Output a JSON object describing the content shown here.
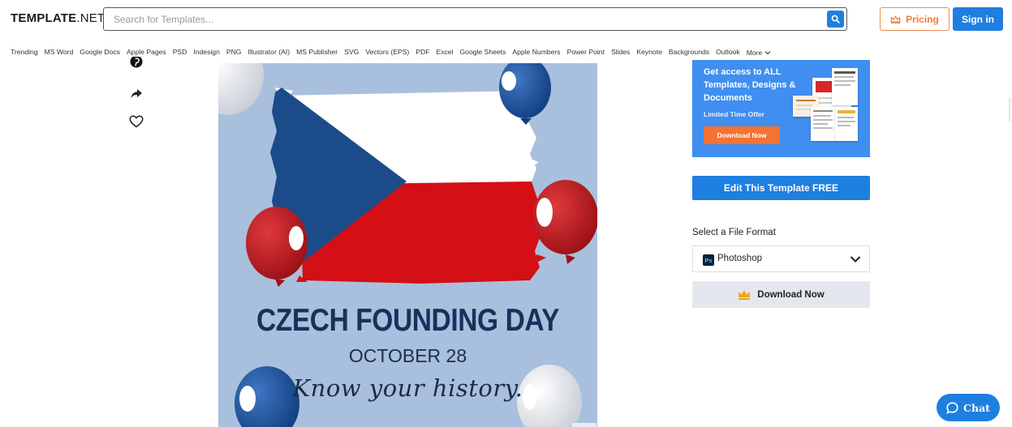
{
  "header": {
    "logo_main": "TEMPLATE",
    "logo_suffix": ".NET",
    "search_placeholder": "Search for Templates...",
    "pricing_label": "Pricing",
    "signin_label": "Sign in"
  },
  "categories": [
    "Trending",
    "MS Word",
    "Google Docs",
    "Apple Pages",
    "PSD",
    "Indesign",
    "PNG",
    "Illustrator (AI)",
    "MS Publisher",
    "SVG",
    "Vectors (EPS)",
    "PDF",
    "Excel",
    "Google Sheets",
    "Apple Numbers",
    "Power Point",
    "Slides",
    "Keynote",
    "Backgrounds",
    "Outlook"
  ],
  "more_label": "More",
  "poster": {
    "title": "CZECH FOUNDING DAY",
    "date": "OCTOBER 28",
    "tagline": "Know your history."
  },
  "promo": {
    "headline": "Get access to ALL Templates, Designs & Documents",
    "subtext": "Limited Time Offer",
    "button": "Download Now"
  },
  "edit_button": "Edit This Template FREE",
  "format": {
    "label": "Select a File Format",
    "badge": "Ps",
    "selected": "Photoshop"
  },
  "download_button": "Download Now",
  "chat_label": "Chat",
  "colors": {
    "primary_blue": "#1e7fe0",
    "accent_orange": "#f47233",
    "poster_bg": "#a8c0dd",
    "flag_blue": "#1c4b8a",
    "flag_red": "#d40f16"
  }
}
